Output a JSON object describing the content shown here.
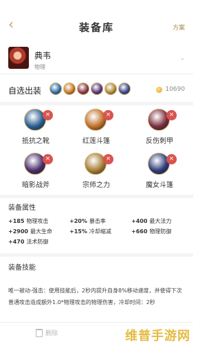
{
  "header": {
    "title": "装备库",
    "right_label": "方案"
  },
  "hero": {
    "name": "典韦",
    "type": "物理"
  },
  "outfit": {
    "label": "自选出装",
    "gold": "10690",
    "mini_icons": [
      {
        "name": "boots-icon",
        "color": "#2f6fa8"
      },
      {
        "name": "cape-icon",
        "color": "#c77a2c"
      },
      {
        "name": "armor-icon",
        "color": "#8e3a46"
      },
      {
        "name": "axe-icon",
        "color": "#5b3a7a"
      },
      {
        "name": "staff-icon",
        "color": "#b68a3a"
      },
      {
        "name": "cloak-icon",
        "color": "#3b4a8a"
      }
    ]
  },
  "items": [
    {
      "label": "抵抗之靴",
      "icon": "boots-icon",
      "color": "#2a5d8f"
    },
    {
      "label": "红莲斗篷",
      "icon": "cape-icon",
      "color": "#c0702a"
    },
    {
      "label": "反伤刺甲",
      "icon": "armor-icon",
      "color": "#7a2e3e"
    },
    {
      "label": "暗影战斧",
      "icon": "axe-icon",
      "color": "#4a2f6a"
    },
    {
      "label": "宗师之力",
      "icon": "staff-icon",
      "color": "#a77d35"
    },
    {
      "label": "魔女斗篷",
      "icon": "cloak-icon",
      "color": "#2f3d7a"
    }
  ],
  "remove_symbol": "×",
  "attributes": {
    "title": "装备属性",
    "rows": [
      [
        {
          "v": "+185",
          "n": "物理攻击"
        },
        {
          "v": "+20%",
          "n": "暴击率"
        },
        {
          "v": "+400",
          "n": "最大法力"
        }
      ],
      [
        {
          "v": "+2900",
          "n": "最大生命"
        },
        {
          "v": "+15%",
          "n": "冷却缩减"
        },
        {
          "v": "+660",
          "n": "物理防御"
        }
      ],
      [
        {
          "v": "+470",
          "n": "法术防御"
        }
      ]
    ]
  },
  "skills": {
    "title": "装备技能",
    "text": "唯一被动-强击：使用技能后，2秒内提升自身8%移动速度，并使得下次普通攻击造成额外1.0*物理攻击的物理伤害，冷却时间：2秒"
  },
  "bottom": {
    "delete_label": "删除"
  },
  "watermark": "维普手游网"
}
